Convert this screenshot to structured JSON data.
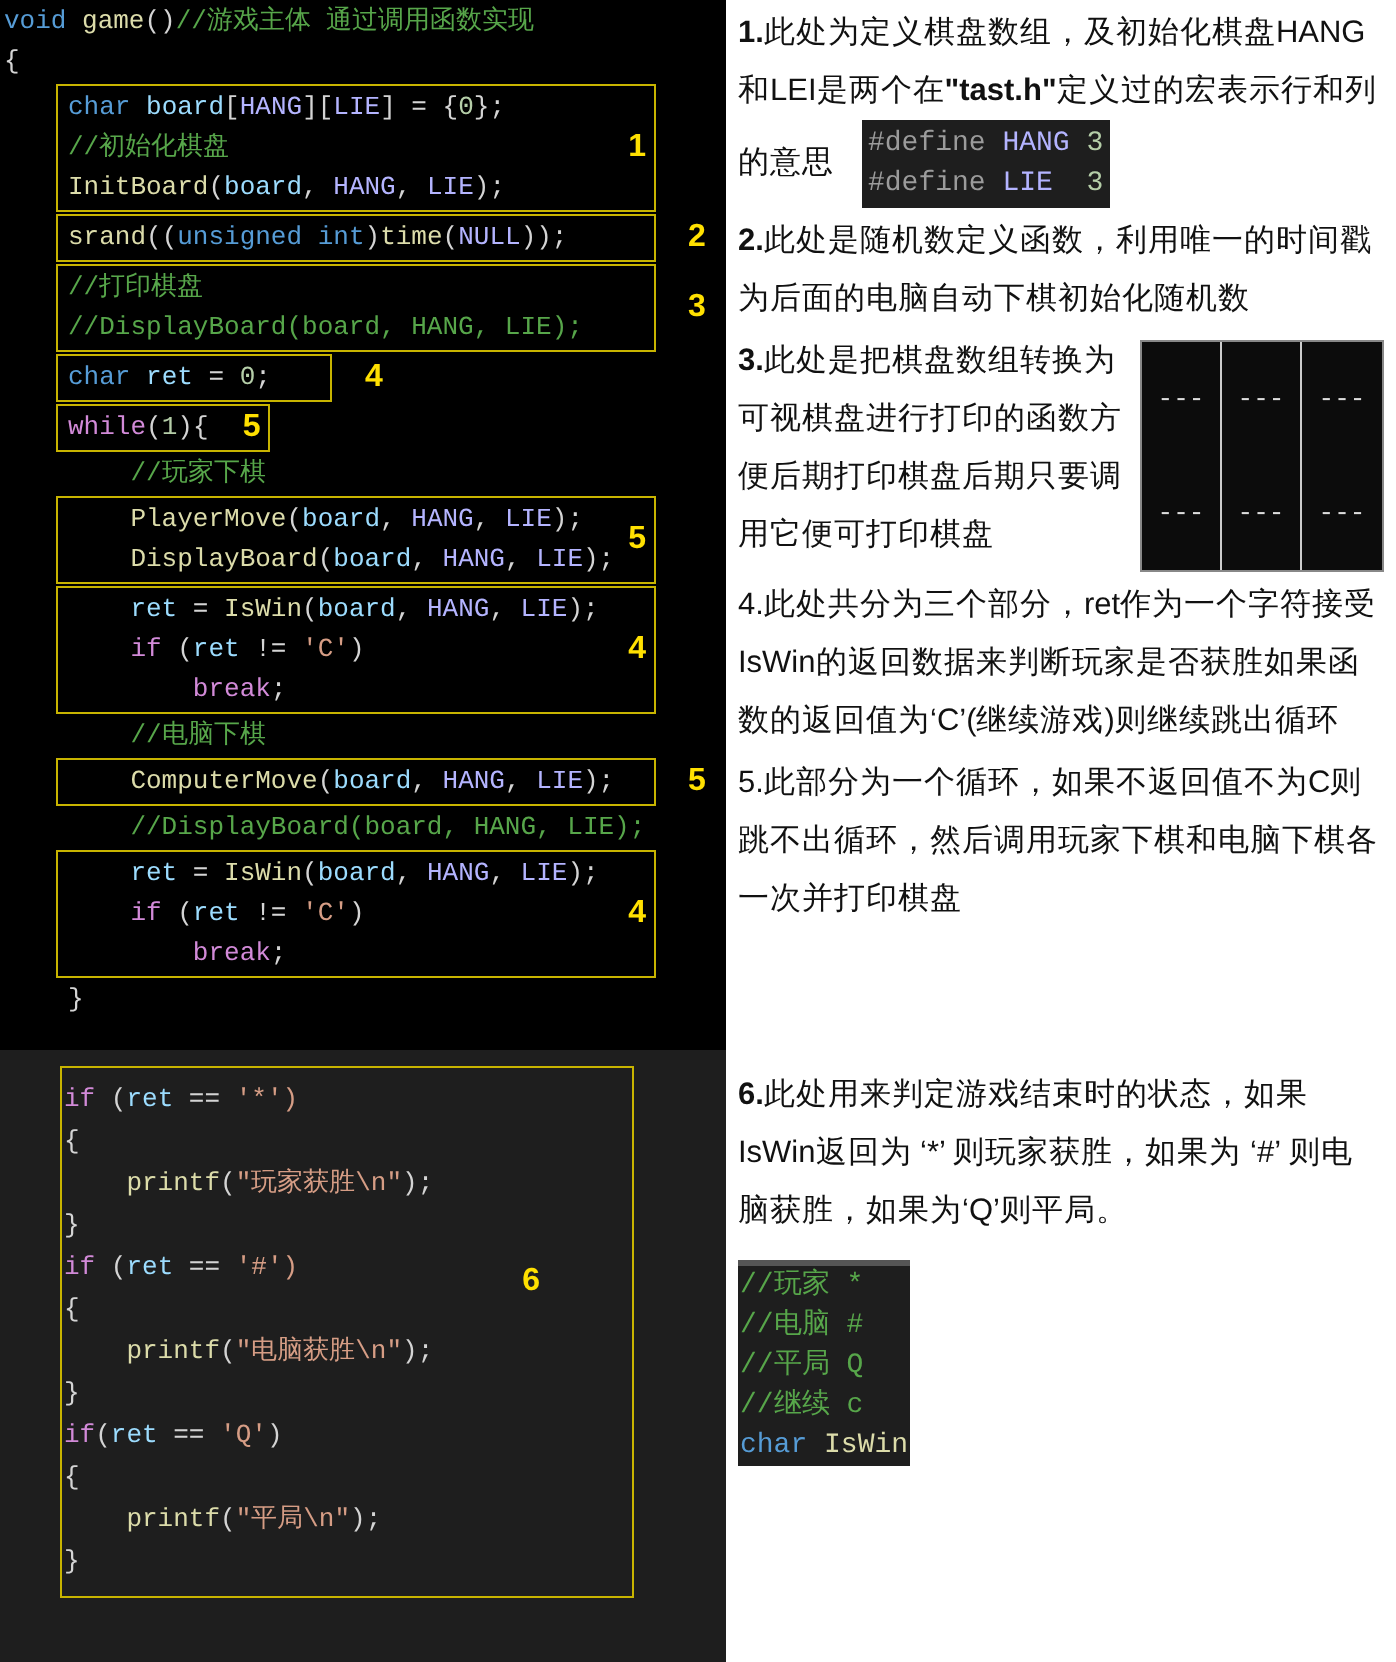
{
  "top_code": {
    "blocks": [
      {
        "kind": "outer",
        "lines": [
          [
            {
              "text": "void",
              "kind": "kw"
            },
            {
              "text": " game",
              "kind": "fn"
            },
            {
              "text": "()",
              "kind": "plain"
            },
            {
              "text": "//游戏主体 通过调用函数实现",
              "kind": "comment"
            }
          ],
          [
            {
              "text": "{",
              "kind": "plain"
            }
          ]
        ]
      },
      {
        "kind": "box",
        "label": "1",
        "lines": [
          [
            {
              "text": "char",
              "kind": "kw"
            },
            {
              "text": " board",
              "kind": "var"
            },
            {
              "text": "[",
              "kind": "plain"
            },
            {
              "text": "HANG",
              "kind": "macro"
            },
            {
              "text": "][",
              "kind": "plain"
            },
            {
              "text": "LIE",
              "kind": "macro"
            },
            {
              "text": "] = {",
              "kind": "plain"
            },
            {
              "text": "0",
              "kind": "num"
            },
            {
              "text": "};",
              "kind": "plain"
            }
          ],
          [
            {
              "text": "//初始化棋盘",
              "kind": "comment"
            }
          ],
          [
            {
              "text": "InitBoard",
              "kind": "fn"
            },
            {
              "text": "(",
              "kind": "plain"
            },
            {
              "text": "board",
              "kind": "var"
            },
            {
              "text": ", ",
              "kind": "plain"
            },
            {
              "text": "HANG",
              "kind": "macro"
            },
            {
              "text": ", ",
              "kind": "plain"
            },
            {
              "text": "LIE",
              "kind": "macro"
            },
            {
              "text": ");",
              "kind": "plain"
            }
          ]
        ]
      },
      {
        "kind": "sidebox",
        "label": "2",
        "lines": [
          [
            {
              "text": "srand",
              "kind": "fn"
            },
            {
              "text": "((",
              "kind": "plain"
            },
            {
              "text": "unsigned int",
              "kind": "kw"
            },
            {
              "text": ")",
              "kind": "plain"
            },
            {
              "text": "time",
              "kind": "fn"
            },
            {
              "text": "(",
              "kind": "plain"
            },
            {
              "text": "NULL",
              "kind": "macro"
            },
            {
              "text": "));",
              "kind": "plain"
            }
          ]
        ]
      },
      {
        "kind": "sidebox",
        "label": "3",
        "lines": [
          [
            {
              "text": "//打印棋盘",
              "kind": "comment"
            }
          ],
          [
            {
              "text": "//DisplayBoard(board, HANG, LIE);",
              "kind": "comment"
            }
          ]
        ]
      },
      {
        "kind": "tightside",
        "label": "4",
        "lines": [
          [
            {
              "text": "char",
              "kind": "kw"
            },
            {
              "text": " ret",
              "kind": "var"
            },
            {
              "text": " = ",
              "kind": "plain"
            },
            {
              "text": "0",
              "kind": "num"
            },
            {
              "text": ";",
              "kind": "plain"
            }
          ]
        ]
      },
      {
        "kind": "tightbox",
        "label": "5",
        "lines": [
          [
            {
              "text": "while",
              "kind": "ctrl"
            },
            {
              "text": "(",
              "kind": "plain"
            },
            {
              "text": "1",
              "kind": "num"
            },
            {
              "text": "){",
              "kind": "plain"
            }
          ]
        ]
      },
      {
        "kind": "body",
        "lines": [
          [
            {
              "text": "    //玩家下棋",
              "kind": "comment"
            }
          ]
        ]
      },
      {
        "kind": "box",
        "label": "5",
        "lines": [
          [
            {
              "text": "    PlayerMove",
              "kind": "fn"
            },
            {
              "text": "(",
              "kind": "plain"
            },
            {
              "text": "board",
              "kind": "var"
            },
            {
              "text": ", ",
              "kind": "plain"
            },
            {
              "text": "HANG",
              "kind": "macro"
            },
            {
              "text": ", ",
              "kind": "plain"
            },
            {
              "text": "LIE",
              "kind": "macro"
            },
            {
              "text": ");",
              "kind": "plain"
            }
          ],
          [
            {
              "text": "    DisplayBoard",
              "kind": "fn"
            },
            {
              "text": "(",
              "kind": "plain"
            },
            {
              "text": "board",
              "kind": "var"
            },
            {
              "text": ", ",
              "kind": "plain"
            },
            {
              "text": "HANG",
              "kind": "macro"
            },
            {
              "text": ", ",
              "kind": "plain"
            },
            {
              "text": "LIE",
              "kind": "macro"
            },
            {
              "text": ");",
              "kind": "plain"
            }
          ]
        ]
      },
      {
        "kind": "box",
        "label": "4",
        "lines": [
          [
            {
              "text": "    ret",
              "kind": "var"
            },
            {
              "text": " = ",
              "kind": "plain"
            },
            {
              "text": "IsWin",
              "kind": "fn"
            },
            {
              "text": "(",
              "kind": "plain"
            },
            {
              "text": "board",
              "kind": "var"
            },
            {
              "text": ", ",
              "kind": "plain"
            },
            {
              "text": "HANG",
              "kind": "macro"
            },
            {
              "text": ", ",
              "kind": "plain"
            },
            {
              "text": "LIE",
              "kind": "macro"
            },
            {
              "text": ");",
              "kind": "plain"
            }
          ],
          [
            {
              "text": "    if",
              "kind": "ctrl"
            },
            {
              "text": " (",
              "kind": "plain"
            },
            {
              "text": "ret",
              "kind": "var"
            },
            {
              "text": " != ",
              "kind": "plain"
            },
            {
              "text": "'C'",
              "kind": "str"
            },
            {
              "text": ")",
              "kind": "plain"
            }
          ],
          [
            {
              "text": "        break",
              "kind": "ctrl"
            },
            {
              "text": ";",
              "kind": "plain"
            }
          ]
        ]
      },
      {
        "kind": "body",
        "lines": [
          [
            {
              "text": "    //电脑下棋",
              "kind": "comment"
            }
          ]
        ]
      },
      {
        "kind": "sidebox",
        "label": "5",
        "lines": [
          [
            {
              "text": "    ComputerMove",
              "kind": "fn"
            },
            {
              "text": "(",
              "kind": "plain"
            },
            {
              "text": "board",
              "kind": "var"
            },
            {
              "text": ", ",
              "kind": "plain"
            },
            {
              "text": "HANG",
              "kind": "macro"
            },
            {
              "text": ", ",
              "kind": "plain"
            },
            {
              "text": "LIE",
              "kind": "macro"
            },
            {
              "text": ");",
              "kind": "plain"
            }
          ]
        ]
      },
      {
        "kind": "body",
        "lines": [
          [
            {
              "text": "    //DisplayBoard(board, HANG, LIE);",
              "kind": "comment"
            }
          ]
        ]
      },
      {
        "kind": "box",
        "label": "4",
        "lines": [
          [
            {
              "text": "    ret",
              "kind": "var"
            },
            {
              "text": " = ",
              "kind": "plain"
            },
            {
              "text": "IsWin",
              "kind": "fn"
            },
            {
              "text": "(",
              "kind": "plain"
            },
            {
              "text": "board",
              "kind": "var"
            },
            {
              "text": ", ",
              "kind": "plain"
            },
            {
              "text": "HANG",
              "kind": "macro"
            },
            {
              "text": ", ",
              "kind": "plain"
            },
            {
              "text": "LIE",
              "kind": "macro"
            },
            {
              "text": ");",
              "kind": "plain"
            }
          ],
          [
            {
              "text": "    if",
              "kind": "ctrl"
            },
            {
              "text": " (",
              "kind": "plain"
            },
            {
              "text": "ret",
              "kind": "var"
            },
            {
              "text": " != ",
              "kind": "plain"
            },
            {
              "text": "'C'",
              "kind": "str"
            },
            {
              "text": ")",
              "kind": "plain"
            }
          ],
          [
            {
              "text": "        break",
              "kind": "ctrl"
            },
            {
              "text": ";",
              "kind": "plain"
            }
          ]
        ]
      },
      {
        "kind": "body",
        "lines": [
          [
            {
              "text": "}",
              "kind": "plain"
            }
          ]
        ]
      }
    ]
  },
  "notes_top": [
    {
      "kind": "define",
      "number": "1.",
      "bold_number": true,
      "text": "此处为定义棋盘数组，及初始化棋盘HANG和LEI是两个在**\"tast.h\"**定义过的宏表示行和列的意思"
    },
    {
      "kind": "text",
      "number": "2.",
      "bold_number": true,
      "text": "此处是随机数定义函数，利用唯一的时间戳为后面的电脑自动下棋初始化随机数"
    },
    {
      "kind": "board",
      "number": "3.",
      "bold_number": true,
      "text": "此处是把棋盘数组转换为可视棋盘进行打印的函数方便后期打印棋盘后期只要调用它便可打印棋盘"
    },
    {
      "kind": "text",
      "number": "4.",
      "bold_number": false,
      "text": "此处共分为三个部分，ret作为一个字符接受IsWin的返回数据来判断玩家是否获胜如果函数的返回值为‘C’(继续游戏)则继续跳出循环"
    },
    {
      "kind": "text",
      "number": "5.",
      "bold_number": false,
      "text": "此部分为一个循环，如果不返回值不为C则跳不出循环，然后调用玩家下棋和电脑下棋各一次并打印棋盘"
    }
  ],
  "define_snippet": [
    [
      {
        "text": "#define",
        "kind": "pre"
      },
      {
        "text": " HANG",
        "kind": "macro"
      },
      {
        "text": " 3",
        "kind": "num"
      }
    ],
    [
      {
        "text": "#define",
        "kind": "pre"
      },
      {
        "text": " LIE",
        "kind": "macro"
      },
      {
        "text": "  3",
        "kind": "num"
      }
    ]
  ],
  "board_output": [
    [
      "---",
      "---",
      "---"
    ],
    [
      "---",
      "---",
      "---"
    ]
  ],
  "bottom_code": {
    "label": "6",
    "lines": [
      [
        {
          "text": "if",
          "kind": "ctrl"
        },
        {
          "text": " (",
          "kind": "plain"
        },
        {
          "text": "ret",
          "kind": "var"
        },
        {
          "text": " == ",
          "kind": "plain"
        },
        {
          "text": "'*')",
          "kind": "str"
        }
      ],
      [
        {
          "text": "{",
          "kind": "plain"
        }
      ],
      [
        {
          "text": "    printf",
          "kind": "fn"
        },
        {
          "text": "(",
          "kind": "plain"
        },
        {
          "text": "\"玩家获胜\\n\"",
          "kind": "str"
        },
        {
          "text": ");",
          "kind": "plain"
        }
      ],
      [
        {
          "text": "}",
          "kind": "plain"
        }
      ],
      [
        {
          "text": "if",
          "kind": "ctrl"
        },
        {
          "text": " (",
          "kind": "plain"
        },
        {
          "text": "ret",
          "kind": "var"
        },
        {
          "text": " == ",
          "kind": "plain"
        },
        {
          "text": "'#')",
          "kind": "str"
        }
      ],
      [
        {
          "text": "{",
          "kind": "plain"
        }
      ],
      [
        {
          "text": "    printf",
          "kind": "fn"
        },
        {
          "text": "(",
          "kind": "plain"
        },
        {
          "text": "\"电脑获胜\\n\"",
          "kind": "str"
        },
        {
          "text": ");",
          "kind": "plain"
        }
      ],
      [
        {
          "text": "}",
          "kind": "plain"
        }
      ],
      [
        {
          "text": "if",
          "kind": "ctrl"
        },
        {
          "text": "(",
          "kind": "plain"
        },
        {
          "text": "ret",
          "kind": "var"
        },
        {
          "text": " == ",
          "kind": "plain"
        },
        {
          "text": "'Q'",
          "kind": "str"
        },
        {
          "text": ")",
          "kind": "plain"
        }
      ],
      [
        {
          "text": "{",
          "kind": "plain"
        }
      ],
      [
        {
          "text": "    printf",
          "kind": "fn"
        },
        {
          "text": "(",
          "kind": "plain"
        },
        {
          "text": "\"平局\\n\"",
          "kind": "str"
        },
        {
          "text": ");",
          "kind": "plain"
        }
      ],
      [
        {
          "text": "}",
          "kind": "plain"
        }
      ]
    ]
  },
  "note_bottom": {
    "number": "6.",
    "bold_number": true,
    "text": "此处用来判定游戏结束时的状态，如果IsWin返回为 ‘*’ 则玩家获胜，如果为 ‘#’ 则电脑获胜，如果为‘Q’则平局。"
  },
  "status_snippet": [
    [
      {
        "text": "//玩家 *",
        "kind": "comment"
      }
    ],
    [
      {
        "text": "//电脑 #",
        "kind": "comment"
      }
    ],
    [
      {
        "text": "//平局 Q",
        "kind": "comment"
      }
    ],
    [
      {
        "text": "//继续 c",
        "kind": "comment"
      }
    ],
    [
      {
        "text": "char",
        "kind": "kw"
      },
      {
        "text": " IsWin",
        "kind": "fn"
      }
    ]
  ]
}
